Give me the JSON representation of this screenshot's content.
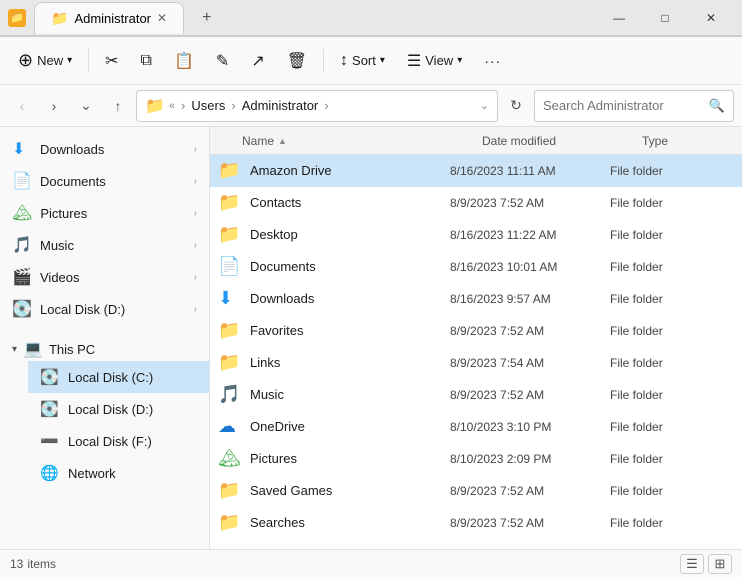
{
  "titleBar": {
    "icon": "📁",
    "title": "Administrator",
    "tabLabel": "Administrator",
    "closeTab": "✕",
    "addTab": "+",
    "minimize": "—",
    "maximize": "□",
    "close": "✕"
  },
  "toolbar": {
    "new_label": "New",
    "new_dropdown": "▾",
    "cut_icon": "✂",
    "copy_icon": "⧉",
    "paste_icon": "📋",
    "rename_icon": "✎",
    "share_icon": "↗",
    "delete_icon": "🗑",
    "sort_label": "Sort",
    "sort_dropdown": "▾",
    "view_label": "View",
    "view_dropdown": "▾",
    "more_icon": "···"
  },
  "navBar": {
    "back": "‹",
    "forward": "›",
    "down": "⌄",
    "up": "↑",
    "folder_icon": "📁",
    "breadcrumbs": [
      "«",
      "Users",
      "Administrator"
    ],
    "expand": "⌄",
    "refresh": "↻",
    "search_placeholder": "Search Administrator",
    "search_icon": "🔍"
  },
  "sidebar": {
    "items": [
      {
        "id": "downloads",
        "icon": "⬇",
        "icon_color": "#2196F3",
        "label": "Downloads",
        "arrow": "›"
      },
      {
        "id": "documents",
        "icon": "📄",
        "icon_color": "#666",
        "label": "Documents",
        "arrow": "›"
      },
      {
        "id": "pictures",
        "icon": "🏔",
        "icon_color": "#4CAF50",
        "label": "Pictures",
        "arrow": "›"
      },
      {
        "id": "music",
        "icon": "🎵",
        "icon_color": "#e53935",
        "label": "Music",
        "arrow": "›"
      },
      {
        "id": "videos",
        "icon": "🎬",
        "icon_color": "#9C27B0",
        "label": "Videos",
        "arrow": "›"
      },
      {
        "id": "localdisk-d-fav",
        "icon": "💽",
        "icon_color": "#555",
        "label": "Local Disk (D:)",
        "arrow": "›"
      }
    ],
    "thispc": {
      "label": "This PC",
      "icon": "💻",
      "expanded": true,
      "children": [
        {
          "id": "localdisk-c",
          "icon": "💽",
          "label": "Local Disk (C:)",
          "selected": true
        },
        {
          "id": "localdisk-d",
          "icon": "💽",
          "label": "Local Disk (D:)"
        },
        {
          "id": "localdisk-f",
          "icon": "➖",
          "label": "Local Disk (F:)"
        },
        {
          "id": "network",
          "icon": "🌐",
          "label": "Network"
        }
      ]
    }
  },
  "fileList": {
    "columns": {
      "name": "Name",
      "dateModified": "Date modified",
      "type": "Type"
    },
    "files": [
      {
        "name": "Amazon Drive",
        "icon": "📁",
        "icon_color": "#89d4f5",
        "date": "8/16/2023 11:11 AM",
        "type": "File folder",
        "selected": true
      },
      {
        "name": "Contacts",
        "icon": "📁",
        "icon_color": "#f5c842",
        "date": "8/9/2023 7:52 AM",
        "type": "File folder"
      },
      {
        "name": "Desktop",
        "icon": "📁",
        "icon_color": "#a0c4f5",
        "date": "8/16/2023 11:22 AM",
        "type": "File folder"
      },
      {
        "name": "Documents",
        "icon": "📄",
        "icon_color": "#4a90d9",
        "date": "8/16/2023 10:01 AM",
        "type": "File folder"
      },
      {
        "name": "Downloads",
        "icon": "⬇",
        "icon_color": "#2196F3",
        "date": "8/16/2023 9:57 AM",
        "type": "File folder"
      },
      {
        "name": "Favorites",
        "icon": "📁",
        "icon_color": "#f5c842",
        "date": "8/9/2023 7:52 AM",
        "type": "File folder"
      },
      {
        "name": "Links",
        "icon": "📁",
        "icon_color": "#f5c842",
        "date": "8/9/2023 7:54 AM",
        "type": "File folder"
      },
      {
        "name": "Music",
        "icon": "🎵",
        "icon_color": "#e53935",
        "date": "8/9/2023 7:52 AM",
        "type": "File folder"
      },
      {
        "name": "OneDrive",
        "icon": "☁",
        "icon_color": "#1976D2",
        "date": "8/10/2023 3:10 PM",
        "type": "File folder"
      },
      {
        "name": "Pictures",
        "icon": "🏔",
        "icon_color": "#4CAF50",
        "date": "8/10/2023 2:09 PM",
        "type": "File folder"
      },
      {
        "name": "Saved Games",
        "icon": "📁",
        "icon_color": "#f5c842",
        "date": "8/9/2023 7:52 AM",
        "type": "File folder"
      },
      {
        "name": "Searches",
        "icon": "📁",
        "icon_color": "#f5c842",
        "date": "8/9/2023 7:52 AM",
        "type": "File folder"
      }
    ]
  },
  "statusBar": {
    "count": "13",
    "items_label": "items",
    "view_details": "☰",
    "view_large": "⊞"
  }
}
